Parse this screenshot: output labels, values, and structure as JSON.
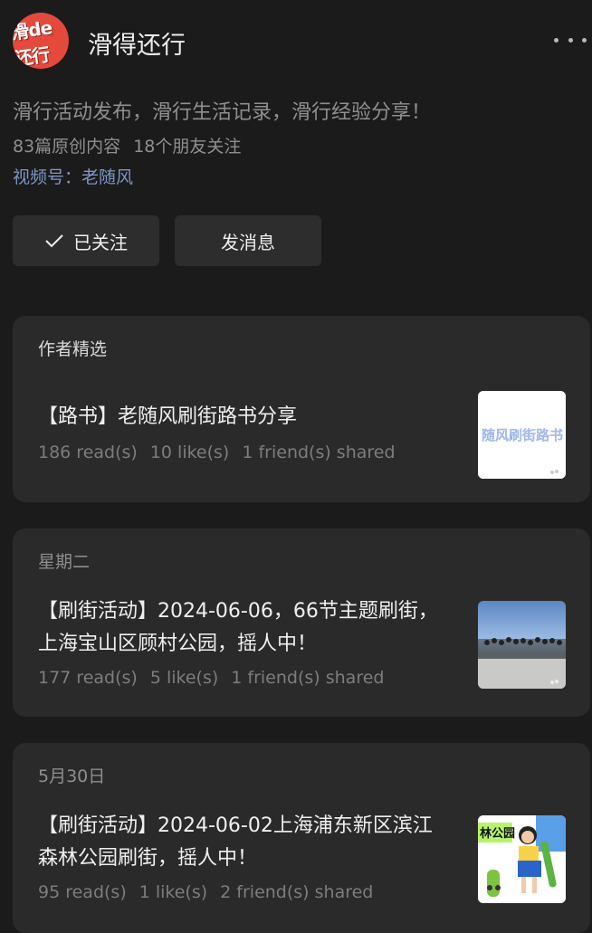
{
  "account": {
    "name": "滑得还行",
    "avatar_text": "滑de还行",
    "description": "滑行活动发布，滑行生活记录，滑行经验分享！",
    "original_count": "83篇原创内容",
    "friends_following": "18个朋友关注",
    "video_channel": "视频号：老随风"
  },
  "actions": {
    "followed_label": "已关注",
    "message_label": "发消息"
  },
  "sections": [
    {
      "label": "作者精选",
      "title": "【路书】老随风刷街路书分享",
      "reads": "186 read(s)",
      "likes": "10 like(s)",
      "shares": "1 friend(s) shared",
      "thumb_text": "随风刷街路书"
    },
    {
      "label": "星期二",
      "title": "【刷街活动】2024-06-06，66节主题刷街，上海宝山区顾村公园，摇人中！",
      "reads": "177 read(s)",
      "likes": "5 like(s)",
      "shares": "1 friend(s) shared"
    },
    {
      "label": "5月30日",
      "title": "【刷街活动】2024-06-02上海浦东新区滨江森林公园刷街，摇人中！",
      "reads": "95 read(s)",
      "likes": "1 like(s)",
      "shares": "2 friend(s) shared",
      "thumb_text": "林公园"
    }
  ],
  "icons": {
    "more": "more-dots-icon",
    "check": "check-icon"
  },
  "colors": {
    "background": "#1b1b1b",
    "card": "#2a2a2a",
    "button": "#2d2d2d",
    "link": "#7f95c6",
    "avatar": "#e5493b"
  }
}
